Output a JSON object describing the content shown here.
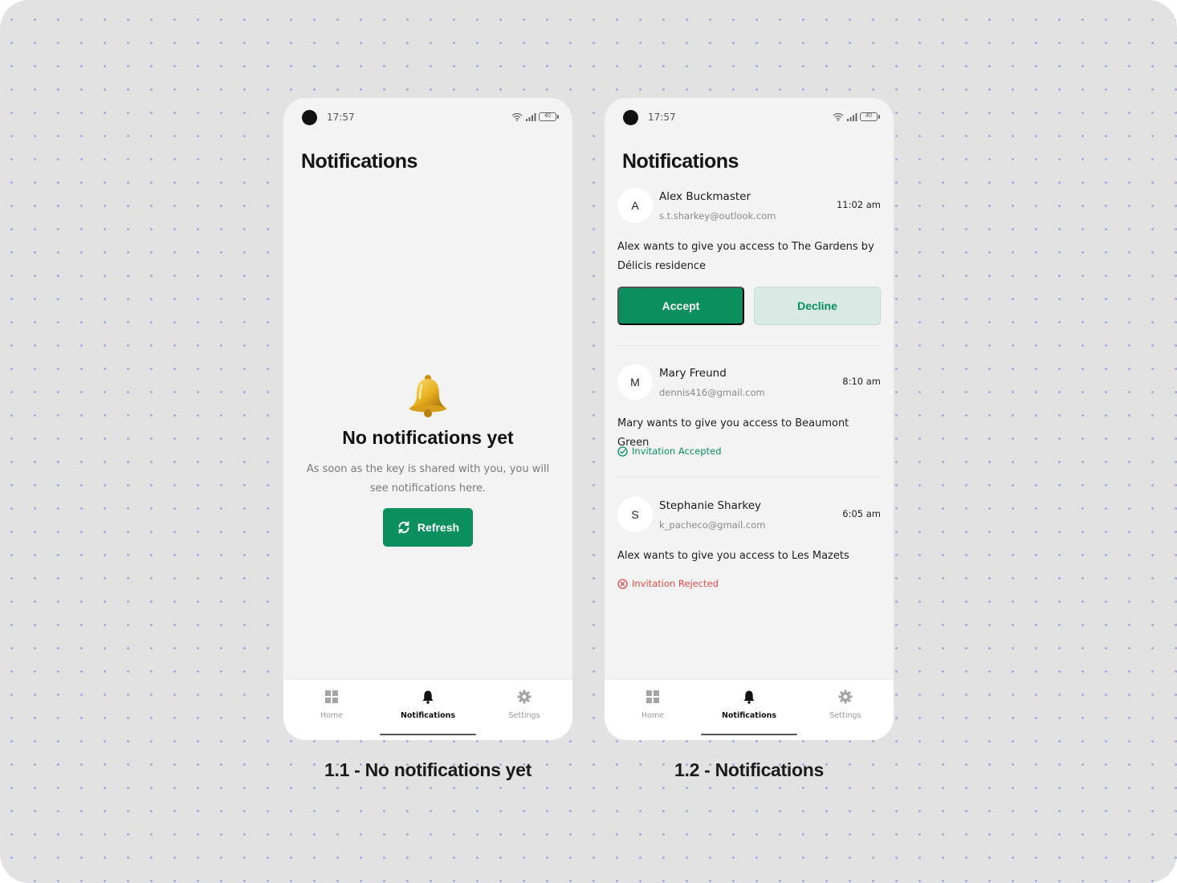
{
  "screens": [
    {
      "status": {
        "time": "17:57",
        "battery": "40"
      },
      "title": "Notifications",
      "empty": {
        "icon": "bell-icon",
        "title": "No notifications yet",
        "description": "As soon as the key is shared with you, you will see notifications here.",
        "refresh_label": "Refresh"
      },
      "caption": "1.1 - No notifications yet"
    },
    {
      "status": {
        "time": "17:57",
        "battery": "40"
      },
      "title": "Notifications",
      "notifications": [
        {
          "initial": "A",
          "name": "Alex Buckmaster",
          "email": "s.t.sharkey@outlook.com",
          "time": "11:02 am",
          "message": "Alex wants to give you access to The Gardens by Délicis residence",
          "accept_label": "Accept",
          "decline_label": "Decline"
        },
        {
          "initial": "M",
          "name": "Mary Freund",
          "email": "dennis416@gmail.com",
          "time": "8:10 am",
          "message": "Mary wants to give you access to Beaumont Green",
          "status_text": "Invitation Accepted"
        },
        {
          "initial": "S",
          "name": "Stephanie Sharkey",
          "email": "k_pacheco@gmail.com",
          "time": "6:05 am",
          "message": "Alex wants to give you access to Les Mazets",
          "status_text": "Invitation Rejected"
        }
      ],
      "caption": "1.2 - Notifications"
    }
  ],
  "tabs": [
    {
      "label": "Home",
      "icon": "grid-icon"
    },
    {
      "label": "Notifications",
      "icon": "bell-icon"
    },
    {
      "label": "Settings",
      "icon": "gear-icon"
    }
  ],
  "colors": {
    "accent": "#0b8f5f",
    "decline_bg": "#d8eae3",
    "rejected": "#e14c4c",
    "canvas": "#e2e2e2",
    "dots": "#9fa4dc"
  }
}
